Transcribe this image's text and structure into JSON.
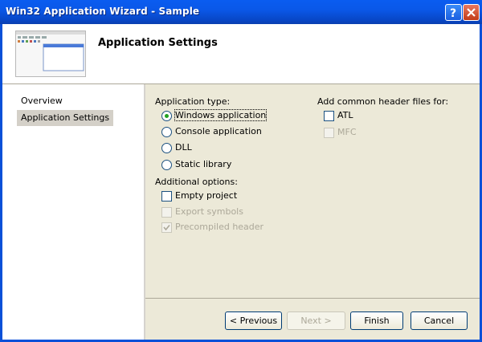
{
  "window": {
    "title": "Win32 Application Wizard - Sample"
  },
  "header": {
    "title": "Application Settings"
  },
  "sidebar": {
    "items": [
      {
        "label": "Overview"
      },
      {
        "label": "Application Settings"
      }
    ]
  },
  "application_type": {
    "label": "Application type:",
    "selected": "Windows application",
    "options": [
      {
        "label": "Windows application"
      },
      {
        "label": "Console application"
      },
      {
        "label": "DLL"
      },
      {
        "label": "Static library"
      }
    ]
  },
  "additional_options": {
    "label": "Additional options:",
    "items": [
      {
        "label": "Empty project",
        "checked": false,
        "enabled": true
      },
      {
        "label": "Export symbols",
        "checked": false,
        "enabled": false
      },
      {
        "label": "Precompiled header",
        "checked": true,
        "enabled": false
      }
    ]
  },
  "common_headers": {
    "label": "Add common header files for:",
    "items": [
      {
        "label": "ATL",
        "checked": false,
        "enabled": true
      },
      {
        "label": "MFC",
        "checked": false,
        "enabled": false
      }
    ]
  },
  "buttons": {
    "previous": "< Previous",
    "next": "Next >",
    "finish": "Finish",
    "cancel": "Cancel"
  },
  "colors": {
    "titlebar": "#0a58e8",
    "client_bg": "#ece9d8",
    "radio_dot": "#21a121",
    "disabled_text": "#aca899"
  }
}
